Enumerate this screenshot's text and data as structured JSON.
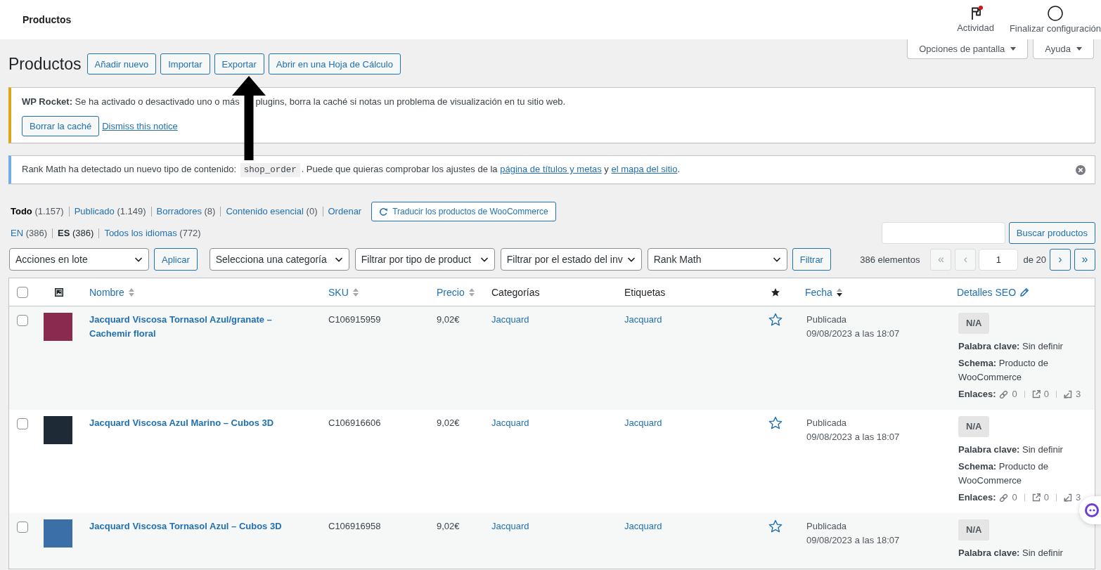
{
  "top_bar": {
    "title": "Productos",
    "actions": [
      {
        "kind": "activity",
        "label": "Actividad",
        "unread": true
      },
      {
        "kind": "setup",
        "label": "Finalizar configuración"
      }
    ]
  },
  "header": {
    "title": "Productos",
    "buttons": [
      "Añadir nuevo",
      "Importar",
      "Exportar",
      "Abrir en una Hoja de Cálculo"
    ],
    "tabs": [
      "Opciones de pantalla",
      "Ayuda"
    ]
  },
  "notices": [
    {
      "kind": "warning",
      "segments": [
        {
          "kind": "text",
          "text": "**WP Rocket:** Se ha activado o desactivado uno o más "
        },
        {
          "kind": "arrow"
        },
        {
          "kind": "text",
          "text": "plugins, borra la caché si notas un problema de visualización en tu sitio web."
        }
      ],
      "button": "Borrar la caché",
      "link": "Dismiss this notice"
    },
    {
      "kind": "info",
      "segments": [
        {
          "kind": "text",
          "text": "Rank Math ha detectado un nuevo tipo de contenido: "
        },
        {
          "kind": "code",
          "text": "shop_order"
        },
        {
          "kind": "text",
          "text": ". Puede que quieras comprobar los ajustes de la "
        },
        {
          "kind": "link",
          "text": "página de títulos y metas"
        },
        {
          "kind": "text",
          "text": " y "
        },
        {
          "kind": "link",
          "text": "el mapa del sitio"
        },
        {
          "kind": "text",
          "text": "."
        }
      ],
      "dismissible": true
    }
  ],
  "views": {
    "items": [
      {
        "label": "Todo",
        "count": "(1.157)",
        "selected": true
      },
      {
        "label": "Publicado",
        "count": "(1.149)",
        "selected": false
      },
      {
        "label": "Borradores",
        "count": "(8)",
        "selected": false
      },
      {
        "label": "Contenido esencial",
        "count": "(0)",
        "selected": false
      },
      {
        "label": "Ordenar",
        "selected": false
      }
    ],
    "translate_button": "Traducir los productos de WooCommerce"
  },
  "languages": [
    {
      "label": "EN",
      "count": "(386)",
      "selected": false
    },
    {
      "label": "ES",
      "count": "(386)",
      "selected": true
    },
    {
      "label": "Todos los idiomas",
      "count": "(772)",
      "selected": false
    }
  ],
  "search": {
    "button": "Buscar productos"
  },
  "bulk_actions": {
    "value": "Acciones en lote",
    "button": "Aplicar"
  },
  "filters": {
    "selects": [
      "Selecciona una categoría",
      "Filtrar por tipo de product",
      "Filtrar por el estado del inv",
      "Rank Math"
    ],
    "button": "Filtrar"
  },
  "pagination": {
    "count": "386 elementos",
    "before": [
      {
        "label": "«",
        "disabled": true
      },
      {
        "label": "‹",
        "disabled": true
      }
    ],
    "current": "1",
    "total": "de 20",
    "after": [
      {
        "label": "›",
        "disabled": false
      },
      {
        "label": "»",
        "disabled": false
      }
    ]
  },
  "table": {
    "columns": [
      {
        "kind": "checkbox",
        "checked": false
      },
      {
        "kind": "image"
      },
      {
        "kind": "sortable",
        "label": "Nombre",
        "sorted": false
      },
      {
        "kind": "sortable",
        "label": "SKU",
        "sorted": false
      },
      {
        "kind": "sortable",
        "label": "Precio",
        "sorted": false
      },
      {
        "kind": "plain",
        "label": "Categorías"
      },
      {
        "kind": "plain",
        "label": "Etiquetas"
      },
      {
        "kind": "featured"
      },
      {
        "kind": "sortable",
        "label": "Fecha",
        "sorted": true,
        "descending": true
      },
      {
        "kind": "edit",
        "label": "Detalles SEO"
      }
    ],
    "rows": [
      {
        "checked": false,
        "thumbnail": {
          "color": "#8a2a4e"
        },
        "name": "Jacquard Viscosa Tornasol Azul/granate – Cachemir floral",
        "sku": "C106915959",
        "price": "9,02€",
        "category": "Jacquard",
        "tag": "Jacquard",
        "featured": false,
        "status": "Publicada",
        "date": "09/08/2023 a las 18:07",
        "seo": {
          "score": "N/A",
          "keyword": "**Palabra clave:** Sin definir",
          "schema": "**Schema:** Producto de WooCommerce",
          "links_label": "Enlaces:",
          "links": [
            {
              "kind": "internal",
              "count": "0"
            },
            {
              "kind": "external",
              "count": "0"
            },
            {
              "kind": "incoming",
              "count": "3"
            }
          ]
        }
      },
      {
        "checked": false,
        "thumbnail": {
          "color": "#1f2a37"
        },
        "name": "Jacquard Viscosa Azul Marino – Cubos 3D",
        "sku": "C106916606",
        "price": "9,02€",
        "category": "Jacquard",
        "tag": "Jacquard",
        "featured": false,
        "status": "Publicada",
        "date": "09/08/2023 a las 18:07",
        "seo": {
          "score": "N/A",
          "keyword": "**Palabra clave:** Sin definir",
          "schema": "**Schema:** Producto de WooCommerce",
          "links_label": "Enlaces:",
          "links": [
            {
              "kind": "internal",
              "count": "0"
            },
            {
              "kind": "external",
              "count": "0"
            },
            {
              "kind": "incoming",
              "count": "3"
            }
          ]
        }
      },
      {
        "checked": false,
        "thumbnail": {
          "color": "#3b6fa8"
        },
        "name": "Jacquard Viscosa Tornasol Azul – Cubos 3D",
        "sku": "C106916958",
        "price": "9,02€",
        "category": "Jacquard",
        "tag": "Jacquard",
        "featured": false,
        "status": "Publicada",
        "date": "09/08/2023 a las 18:07",
        "seo": {
          "score": "N/A",
          "keyword": "**Palabra clave:** Sin definir"
        }
      }
    ]
  }
}
